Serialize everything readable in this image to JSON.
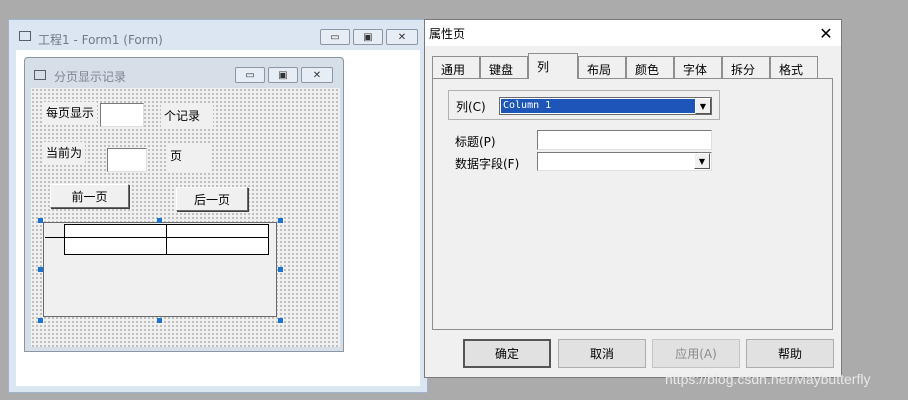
{
  "project_window": {
    "title": "工程1 - Form1 (Form)",
    "min": "▭",
    "max": "▣",
    "close": "✕"
  },
  "form_window": {
    "title": "分页显示记录",
    "min": "▭",
    "max": "▣",
    "close": "✕"
  },
  "form": {
    "per_page_label": "每页显示",
    "records_label": "个记录",
    "current_label": "当前为",
    "page_label": "页",
    "prev_button": "前一页",
    "next_button": "后一页"
  },
  "dialog": {
    "title": "属性页",
    "close": "✕",
    "tabs": [
      "通用",
      "键盘",
      "列",
      "布局",
      "颜色",
      "字体",
      "拆分",
      "格式"
    ],
    "active_tab": "列",
    "column_label": "列(C)",
    "column_value": "Column 1",
    "caption_label": "标题(P)",
    "caption_value": "",
    "datafield_label": "数据字段(F)",
    "datafield_value": "",
    "buttons": {
      "ok": "确定",
      "cancel": "取消",
      "apply": "应用(A)",
      "help": "帮助"
    }
  },
  "watermark": "https://blog.csdn.net/Maybutterfly",
  "colors": {
    "selection": "#1d56b8",
    "handles": "#1e72d0"
  }
}
